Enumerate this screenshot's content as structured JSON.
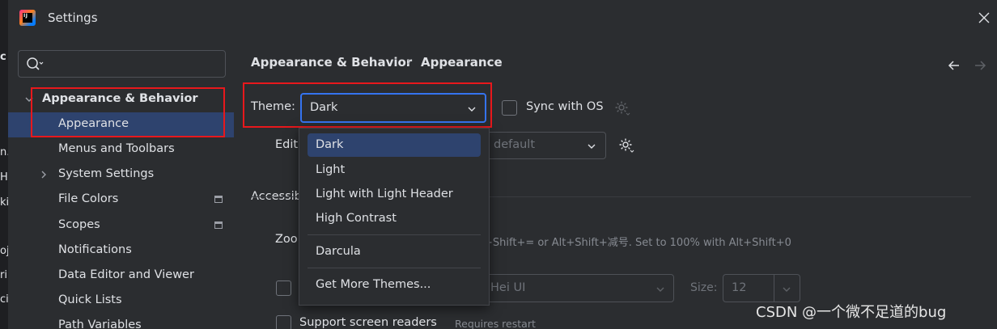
{
  "window": {
    "title": "Settings"
  },
  "left_edge_fragments": [
    "c",
    "n.i",
    "He",
    "ki",
    "oj",
    "ri",
    "ci"
  ],
  "search": {
    "placeholder": ""
  },
  "nav": {
    "items": [
      {
        "label": "Appearance & Behavior",
        "expanded": true
      },
      {
        "label": "Appearance",
        "selected": true
      },
      {
        "label": "Menus and Toolbars"
      },
      {
        "label": "System Settings",
        "expandable": true
      },
      {
        "label": "File Colors"
      },
      {
        "label": "Scopes"
      },
      {
        "label": "Notifications"
      },
      {
        "label": "Data Editor and Viewer"
      },
      {
        "label": "Quick Lists"
      },
      {
        "label": "Path Variables"
      }
    ]
  },
  "breadcrumb": {
    "parent": "Appearance & Behavior",
    "current": "Appearance"
  },
  "theme": {
    "label": "Theme:",
    "selected": "Dark",
    "sync_label": "Sync with OS",
    "options": [
      "Dark",
      "Light",
      "Light with Light Header",
      "High Contrast",
      "Darcula",
      "Get More Themes..."
    ]
  },
  "editor": {
    "label_fragment": "Edit",
    "scheme_value": "default"
  },
  "accessibility": {
    "heading_fragment": "Accessib",
    "zoom_label_fragment": "Zoo",
    "zoom_hint": "+Shift+= or Alt+Shift+减号. Set to 100% with Alt+Shift+0",
    "font_value_fragment": "Hei UI",
    "size_label": "Size:",
    "size_value": "12",
    "screen_readers_label": "Support screen readers",
    "requires_restart": "Requires restart"
  },
  "watermark": "CSDN @一个微不足道的bug",
  "colors": {
    "background": "#2b2d30",
    "selection": "#2e436e",
    "focus": "#3574f0",
    "highlight_box": "#e8181c"
  }
}
